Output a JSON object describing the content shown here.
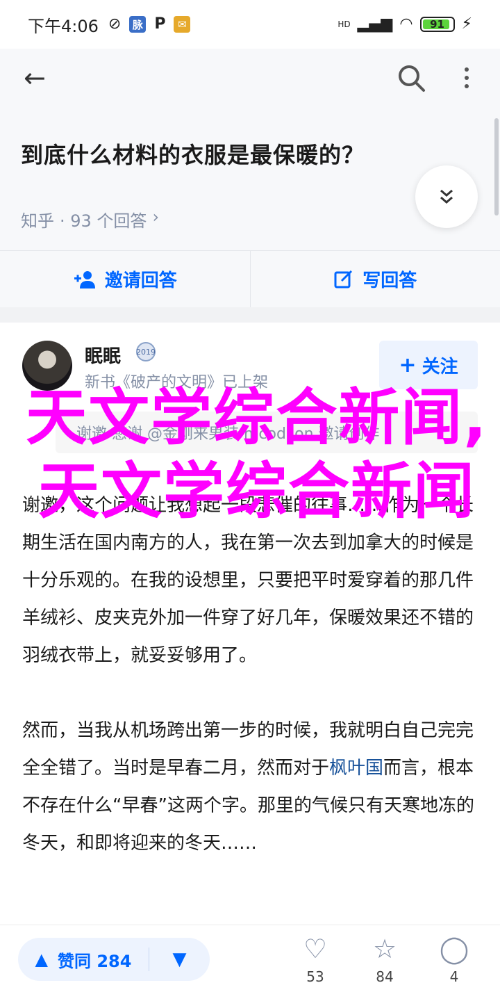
{
  "status_bar": {
    "time": "下午4:06",
    "icon_box_1": "脉",
    "icon_p": "P",
    "network": "HD",
    "battery": "91"
  },
  "question": {
    "title": "到底什么材料的衣服是最保暖的？",
    "source": "知乎",
    "answers_count": "· 93 个回答",
    "chevron": "›"
  },
  "actions": {
    "invite": "邀请回答",
    "write": "写回答"
  },
  "answer": {
    "author": "眠眠",
    "badge": "2019",
    "author_desc": "新书《破产的文明》已上架",
    "follow": "关注",
    "invite_row": "谢邀  感谢 @金刚来男装  mcodlion 邀请创作",
    "paragraphs": [
      "谢邀，这个问题让我想起一段悲催的往事……作为一个长期生活在国内南方的人，我在第一次去到加拿大的时候是十分乐观的。在我的设想里，只要把平时爱穿着的那几件羊绒衫、皮夹克外加一件穿了好几年，保暖效果还不错的羽绒衣带上，就妥妥够用了。"
    ],
    "para2_link": "枫叶国",
    "para2_before": "然而，当我从机场跨出第一步的时候，我就明白自己完完全全错了。当时是早春二月，然而对于",
    "para2_after": "而言，根本不存在什么“早春”这两个字。那里的气候只有天寒地冻的冬天，和即将迎来的冬天……"
  },
  "overlay": {
    "text": "天文学综合新闻,天文学综合新闻"
  },
  "bottom_bar": {
    "upvote": "赞同 284",
    "like_count": "53",
    "favorite_count": "84",
    "comment_count": "4"
  },
  "colors": {
    "accent": "#0066ff",
    "overlay": "#ff00ff",
    "meta": "#8590a6"
  }
}
